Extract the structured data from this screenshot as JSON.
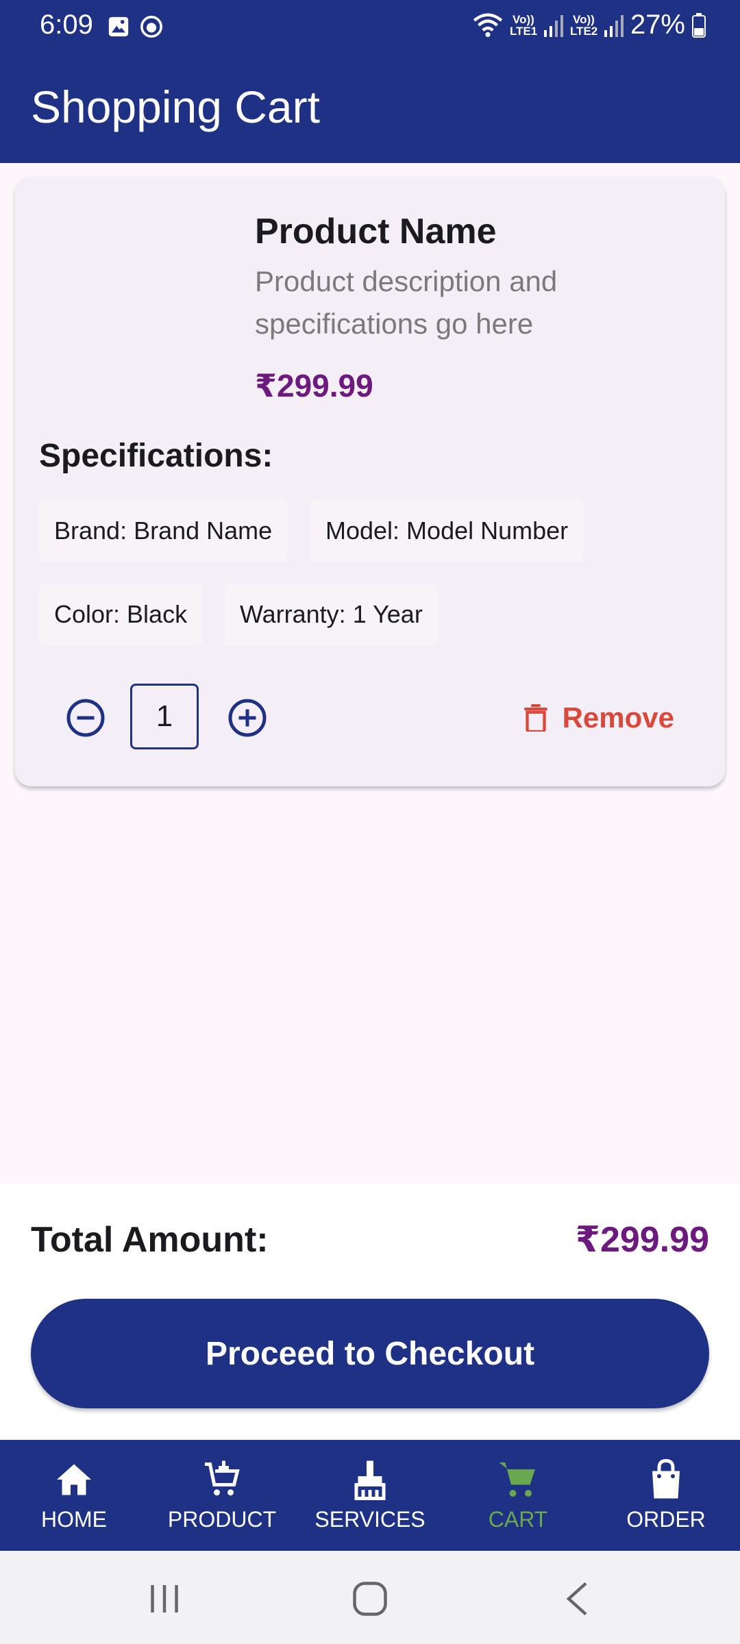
{
  "status_bar": {
    "time": "6:09",
    "battery_percent": "27%",
    "sim1_label": "Vo)) LTE1",
    "sim2_label": "Vo)) LTE2"
  },
  "app_bar": {
    "title": "Shopping Cart"
  },
  "cart_item": {
    "name": "Product Name",
    "description": "Product description and specifications go here",
    "price": "₹299.99",
    "specifications_title": "Specifications:",
    "specs": [
      "Brand: Brand Name",
      "Model: Model Number",
      "Color: Black",
      "Warranty: 1 Year"
    ],
    "quantity": "1",
    "remove_label": "Remove"
  },
  "summary": {
    "total_label": "Total Amount:",
    "total_value": "₹299.99",
    "checkout_label": "Proceed to Checkout"
  },
  "bottom_nav": {
    "items": [
      {
        "label": "HOME",
        "icon": "home-icon"
      },
      {
        "label": "PRODUCT",
        "icon": "cart-add-icon"
      },
      {
        "label": "SERVICES",
        "icon": "cleaning-brush-icon"
      },
      {
        "label": "CART",
        "icon": "shopping-cart-icon",
        "active": true
      },
      {
        "label": "ORDER",
        "icon": "shopping-bag-icon"
      }
    ]
  },
  "colors": {
    "primary": "#1f3184",
    "price": "#6c1a7e",
    "remove": "#d9493b",
    "active_nav": "#6aa84f"
  }
}
